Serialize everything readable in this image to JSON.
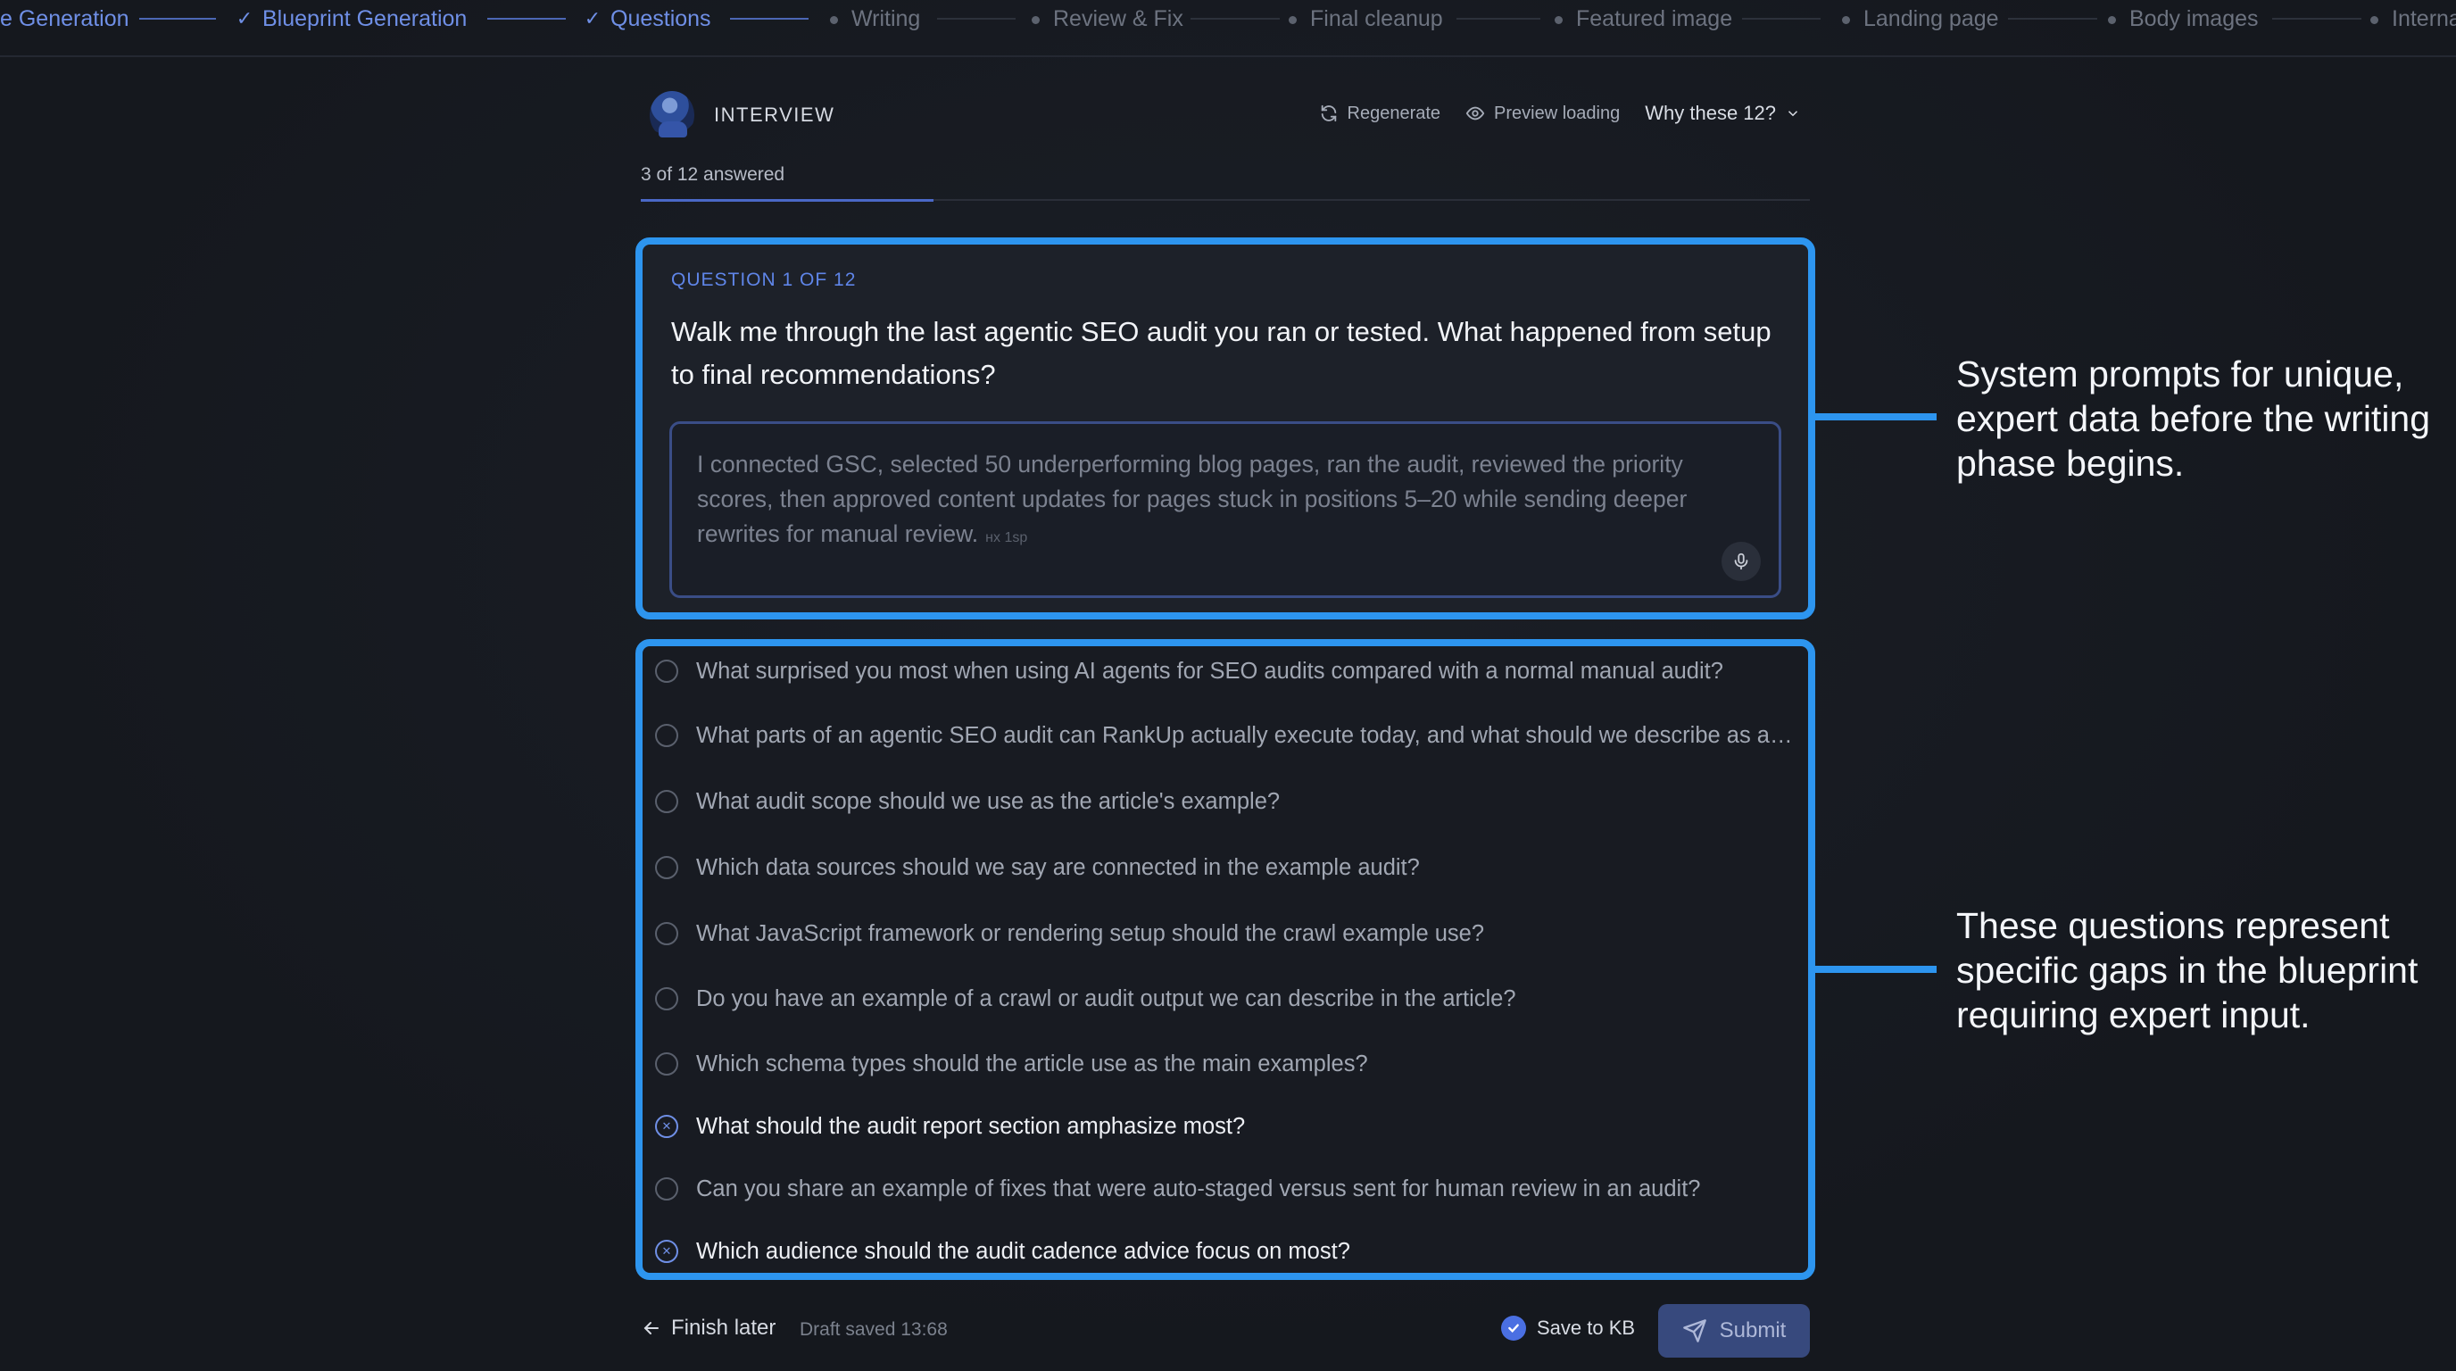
{
  "stepper": [
    {
      "label": "e Generation",
      "done": true
    },
    {
      "label": "Blueprint Generation",
      "done": true
    },
    {
      "label": "Questions",
      "done": true
    },
    {
      "label": "Writing",
      "done": false
    },
    {
      "label": "Review & Fix",
      "done": false
    },
    {
      "label": "Final cleanup",
      "done": false
    },
    {
      "label": "Featured image",
      "done": false
    },
    {
      "label": "Landing page",
      "done": false
    },
    {
      "label": "Body images",
      "done": false
    },
    {
      "label": "Interna",
      "done": false
    }
  ],
  "header": {
    "title": "INTERVIEW",
    "regenerate": "Regenerate",
    "preview": "Preview loading",
    "why": "Why these 12?"
  },
  "progress": {
    "text": "3 of 12 answered",
    "fraction": 0.25
  },
  "question": {
    "label": "QUESTION 1 OF 12",
    "text": "Walk me through the last agentic SEO audit you ran or tested. What happened from setup to final recommendations?",
    "answer": "I connected GSC, selected 50 underperforming blog pages, ran the audit, reviewed the priority scores, then approved content updates for pages stuck in positions 5–20 while sending deeper rewrites for manual review.",
    "answer_time": "нх 1sp"
  },
  "questions": [
    {
      "text": "What surprised you most when using AI agents for SEO audits compared with a normal manual audit?",
      "answered": false
    },
    {
      "text": "What parts of an agentic SEO audit can RankUp actually execute today, and what should we describe as aspirational?",
      "answered": false
    },
    {
      "text": "What audit scope should we use as the article's example?",
      "answered": false
    },
    {
      "text": "Which data sources should we say are connected in the example audit?",
      "answered": false
    },
    {
      "text": "What JavaScript framework or rendering setup should the crawl example use?",
      "answered": false
    },
    {
      "text": "Do you have an example of a crawl or audit output we can describe in the article?",
      "answered": false
    },
    {
      "text": "Which schema types should the article use as the main examples?",
      "answered": false
    },
    {
      "text": "What should the audit report section amphasize most?",
      "answered": true
    },
    {
      "text": "Can you share an example of fixes that were auto-staged versus sent for human review in an audit?",
      "answered": false
    },
    {
      "text": "Which audience should the audit cadence advice focus on most?",
      "answered": true
    }
  ],
  "callouts": {
    "top": "System prompts for unique, expert data before the writing phase begins.",
    "bottom": "These questions represent specific gaps in the blueprint requiring expert input."
  },
  "footer": {
    "finish": "Finish later",
    "draft": "Draft saved 13:68",
    "save_kb": "Save to KB",
    "submit": "Submit"
  },
  "colors": {
    "highlight": "#2d95ef",
    "accent": "#6f8fe6",
    "submit_bg": "#37497d"
  }
}
